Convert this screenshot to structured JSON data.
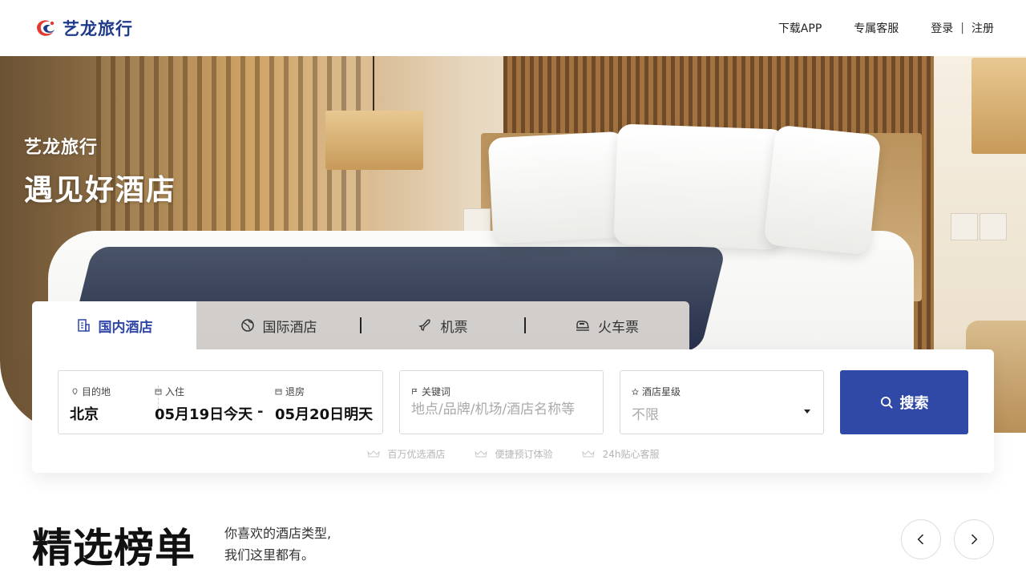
{
  "brand": {
    "name": "艺龙旅行",
    "colors": {
      "primary": "#3049a7",
      "logo_red": "#e23a2f",
      "logo_blue": "#1f3a8a"
    }
  },
  "header": {
    "download_app": "下载APP",
    "customer_service": "专属客服",
    "login": "登录",
    "separator": "|",
    "register": "注册"
  },
  "hero": {
    "subtitle": "艺龙旅行",
    "title": "遇见好酒店",
    "background": "hotel-bedroom-photo"
  },
  "tabs": [
    {
      "label": "国内酒店",
      "icon": "building-icon",
      "active": true
    },
    {
      "label": "国际酒店",
      "icon": "globe-icon",
      "active": false
    },
    {
      "label": "机票",
      "icon": "airplane-icon",
      "active": false
    },
    {
      "label": "火车票",
      "icon": "train-icon",
      "active": false
    }
  ],
  "search": {
    "destination": {
      "label": "目的地",
      "value": "北京",
      "icon": "location-pin-icon"
    },
    "checkin": {
      "label": "入住",
      "value": "05月19日今天",
      "icon": "calendar-icon"
    },
    "date_separator": "-",
    "checkout": {
      "label": "退房",
      "value": "05月20日明天",
      "icon": "calendar-icon"
    },
    "keyword": {
      "label": "关键词",
      "placeholder": "地点/品牌/机场/酒店名称等",
      "value": "",
      "icon": "flag-icon"
    },
    "star": {
      "label": "酒店星级",
      "value": "不限",
      "icon": "star-icon"
    },
    "button_label": "搜索",
    "features": [
      "百万优选酒店",
      "便捷预订体验",
      "24h贴心客服"
    ]
  },
  "ranking": {
    "title": "精选榜单",
    "desc_line1": "你喜欢的酒店类型,",
    "desc_line2": "我们这里都有。"
  }
}
